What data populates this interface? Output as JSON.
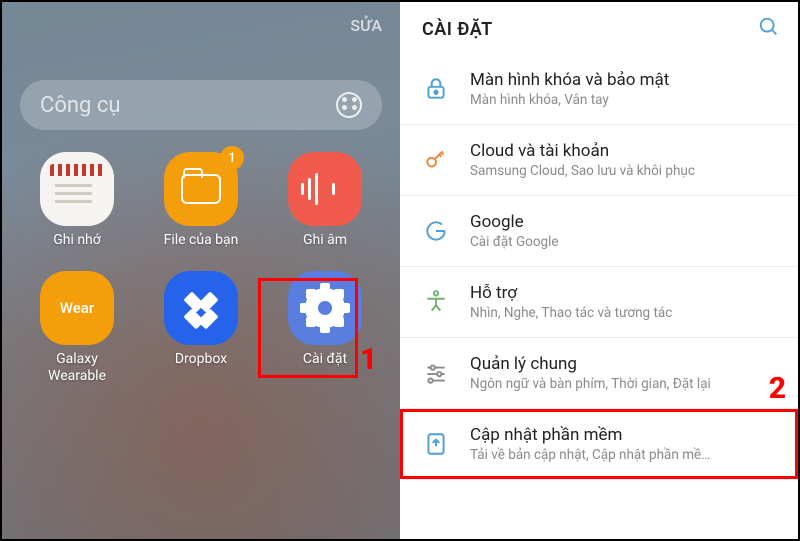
{
  "left": {
    "edit_label": "SỬA",
    "folder_title": "Công cụ",
    "apps": [
      {
        "label": "Ghi nhớ"
      },
      {
        "label": "File của bạn",
        "badge": "1"
      },
      {
        "label": "Ghi âm"
      },
      {
        "label_line1": "Galaxy",
        "label_line2": "Wearable",
        "text": "Wear"
      },
      {
        "label": "Dropbox"
      },
      {
        "label": "Cài đặt"
      }
    ],
    "annotation_1": "1"
  },
  "right": {
    "title": "CÀI ĐẶT",
    "annotation_2": "2",
    "rows": [
      {
        "title": "Màn hình khóa và bảo mật",
        "sub": "Màn hình khóa, Vân tay"
      },
      {
        "title": "Cloud và tài khoản",
        "sub": "Samsung Cloud, Sao lưu và khôi phục"
      },
      {
        "title": "Google",
        "sub": "Cài đặt Google"
      },
      {
        "title": "Hỗ trợ",
        "sub": "Nhìn, Nghe, Thao tác và tương tác"
      },
      {
        "title": "Quản lý chung",
        "sub": "Ngôn ngữ và bàn phím, Thời gian, Đặt lại"
      },
      {
        "title": "Cập nhật phần mềm",
        "sub": "Tải về bản cập nhật, Cập nhật phần mề…"
      }
    ]
  }
}
